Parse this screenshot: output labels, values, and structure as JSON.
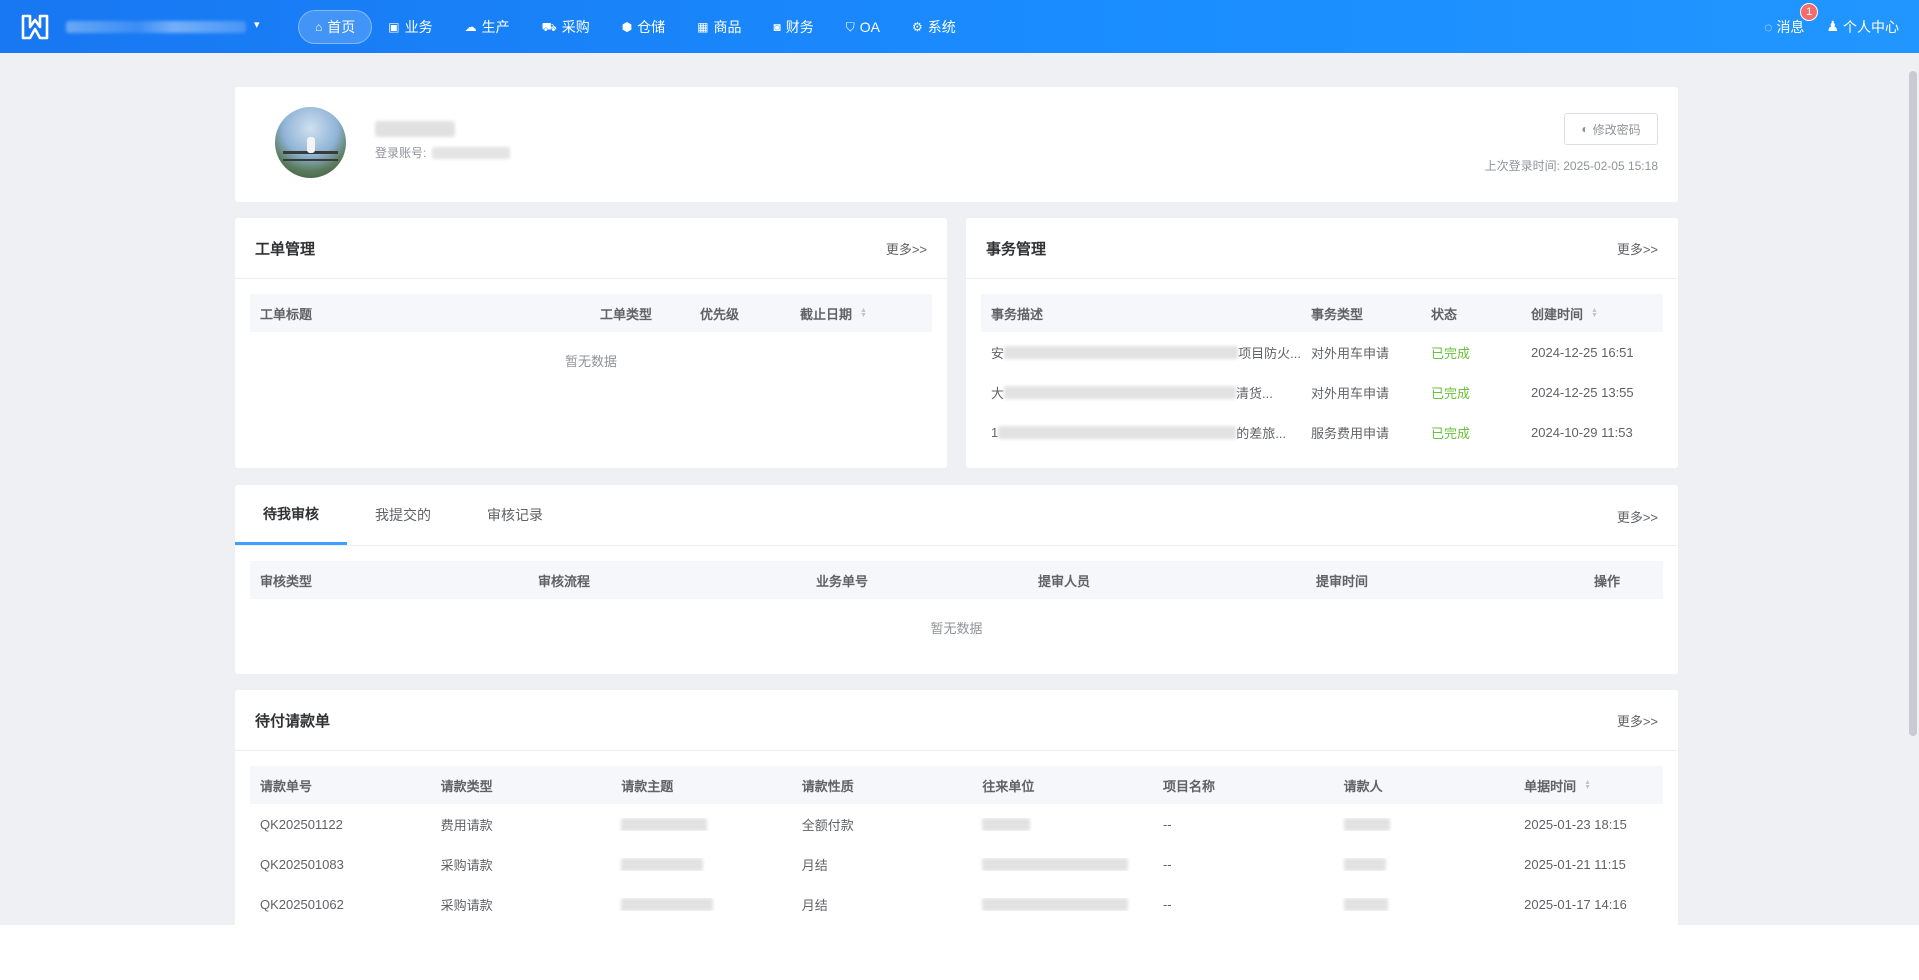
{
  "nav": {
    "items": [
      {
        "label": "首页",
        "icon": "home-icon",
        "active": true
      },
      {
        "label": "业务",
        "icon": "business-icon"
      },
      {
        "label": "生产",
        "icon": "production-icon"
      },
      {
        "label": "采购",
        "icon": "cart-icon"
      },
      {
        "label": "仓储",
        "icon": "warehouse-icon"
      },
      {
        "label": "商品",
        "icon": "goods-icon"
      },
      {
        "label": "财务",
        "icon": "finance-icon"
      },
      {
        "label": "OA",
        "icon": "shield-icon"
      },
      {
        "label": "系统",
        "icon": "system-icon"
      }
    ],
    "messages_label": "消息",
    "messages_badge": "1",
    "profile_label": "个人中心"
  },
  "profile": {
    "account_label": "登录账号:",
    "change_password_label": "修改密码",
    "last_login": "上次登录时间: 2025-02-05 15:18"
  },
  "workorder": {
    "title": "工单管理",
    "more": "更多>>",
    "columns": [
      "工单标题",
      "工单类型",
      "优先级",
      "截止日期"
    ],
    "empty": "暂无数据"
  },
  "affairs": {
    "title": "事务管理",
    "more": "更多>>",
    "columns": [
      "事务描述",
      "事务类型",
      "状态",
      "创建时间"
    ],
    "rows": [
      {
        "desc_start": "安",
        "desc_end": "项目防火...",
        "type": "对外用车申请",
        "status": "已完成",
        "time": "2024-12-25 16:51"
      },
      {
        "desc_start": "大",
        "desc_end": "清货...",
        "type": "对外用车申请",
        "status": "已完成",
        "time": "2024-12-25 13:55"
      },
      {
        "desc_start": "1",
        "desc_end": "的差旅...",
        "type": "服务费用申请",
        "status": "已完成",
        "time": "2024-10-29 11:53"
      }
    ]
  },
  "audit": {
    "tabs": [
      "待我审核",
      "我提交的",
      "审核记录"
    ],
    "more": "更多>>",
    "columns": [
      "审核类型",
      "审核流程",
      "业务单号",
      "提审人员",
      "提审时间",
      "操作"
    ],
    "empty": "暂无数据"
  },
  "payment": {
    "title": "待付请款单",
    "more": "更多>>",
    "columns": [
      "请款单号",
      "请款类型",
      "请款主题",
      "请款性质",
      "往来单位",
      "项目名称",
      "请款人",
      "单据时间"
    ],
    "rows": [
      {
        "no": "QK202501122",
        "type": "费用请款",
        "nature": "全额付款",
        "project": "--",
        "time": "2025-01-23 18:15"
      },
      {
        "no": "QK202501083",
        "type": "采购请款",
        "nature": "月结",
        "project": "--",
        "time": "2025-01-21 11:15"
      },
      {
        "no": "QK202501062",
        "type": "采购请款",
        "nature": "月结",
        "project": "--",
        "time": "2025-01-17 14:16"
      }
    ]
  }
}
